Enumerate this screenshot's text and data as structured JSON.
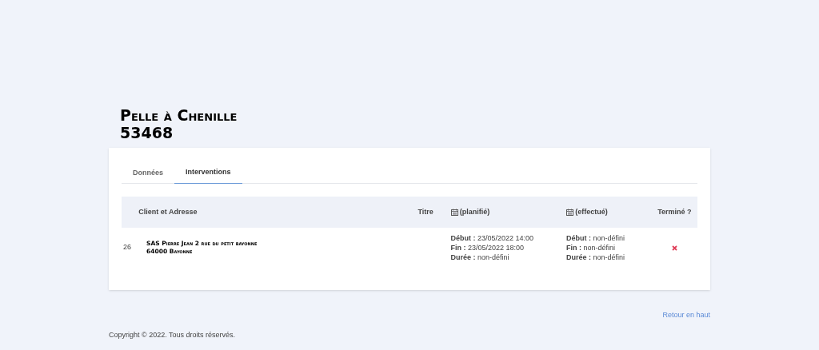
{
  "title": [
    "Pelle à Chenille",
    "53468"
  ],
  "tabs": [
    {
      "label": "Données",
      "selected": false
    },
    {
      "label": "Interventions",
      "selected": true
    }
  ],
  "table": {
    "columns": [
      {
        "label": "Client et Adresse",
        "calendar": false
      },
      {
        "label": "Titre",
        "calendar": false
      },
      {
        "label": "(planifié)",
        "calendar": true
      },
      {
        "label": "(effectué)",
        "calendar": true
      },
      {
        "label": "Terminé ?",
        "calendar": false
      }
    ],
    "rows": [
      {
        "id": "26",
        "client": [
          "SAS Pierre Jean 2 rue du petit bayonne",
          "64000 Bayonne"
        ],
        "planned": [
          "**Début :** 23/05/2022 14:00",
          "**Fin :** 23/05/2022 18:00",
          "**Durée :** non-défini"
        ],
        "done_dates": [
          "**Début :** non-défini",
          "**Fin :** non-défini",
          "**Durée :** non-défini"
        ],
        "finished": false
      }
    ]
  },
  "back_to_top": "Retour en haut",
  "copyright": "Copyright © 2022. Tous droits réservés."
}
